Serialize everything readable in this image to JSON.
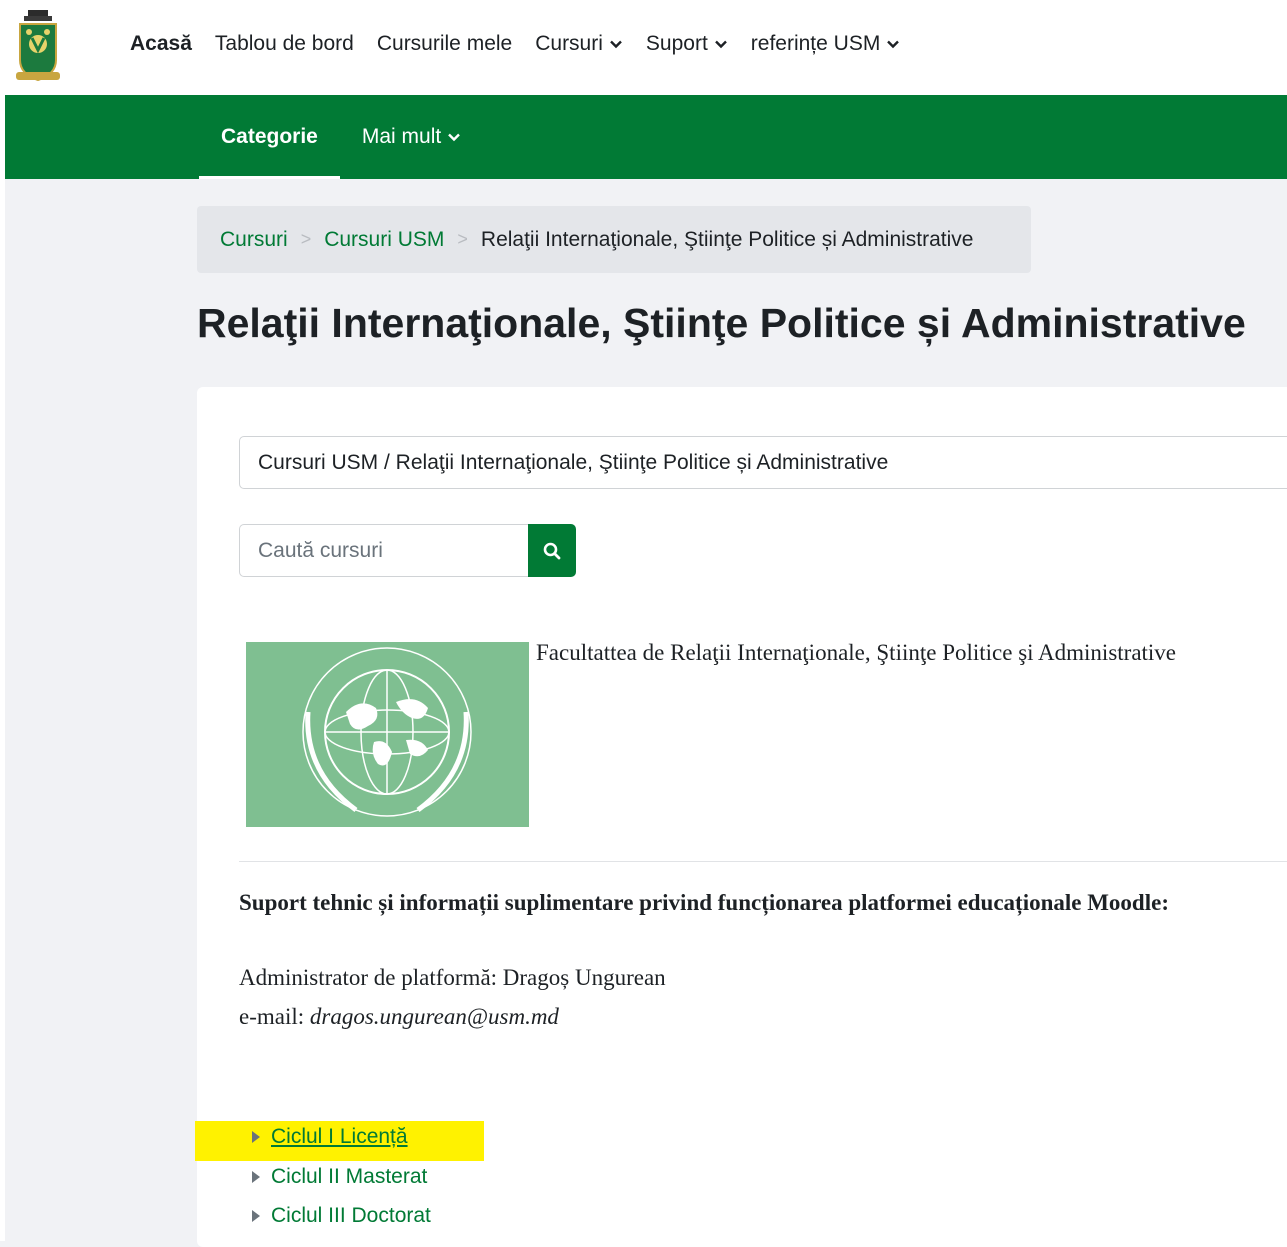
{
  "topnav": {
    "items": [
      {
        "label": "Acasă"
      },
      {
        "label": "Tablou de bord"
      },
      {
        "label": "Cursurile mele"
      },
      {
        "label": "Cursuri"
      },
      {
        "label": "Suport"
      },
      {
        "label": "referințe USM"
      }
    ]
  },
  "secondary_nav": {
    "tabs": [
      {
        "label": "Categorie"
      },
      {
        "label": "Mai mult"
      }
    ]
  },
  "breadcrumb": {
    "items": [
      "Cursuri",
      "Cursuri USM",
      "Relaţii Internaţionale, Ştiinţe Politice și Administrative"
    ]
  },
  "page": {
    "title": "Relaţii Internaţionale, Ştiinţe Politice și Administrative"
  },
  "category_select": {
    "value": "Cursuri USM / Relaţii Internaţionale, Ştiinţe Politice și Administrative"
  },
  "search": {
    "placeholder": "Caută cursuri"
  },
  "description": {
    "faculty_name": "Facultattea de Relaţii Internaţionale, Ştiinţe Politice şi Administrative",
    "support_heading": "Suport tehnic și informații suplimentare privind funcționarea platformei educaționale Moodle:",
    "admin_line": "Administrator de platformă: Dragoș Ungurean",
    "email_label": "e-mail: ",
    "email_value": "dragos.ungurean@usm.md"
  },
  "categories": [
    {
      "label": "Ciclul I Licență"
    },
    {
      "label": "Ciclul II Masterat"
    },
    {
      "label": "Ciclul III Doctorat"
    }
  ],
  "colors": {
    "brand_green": "#017a35",
    "highlight": "#fff200",
    "faculty_image_bg": "#7fbf91"
  }
}
